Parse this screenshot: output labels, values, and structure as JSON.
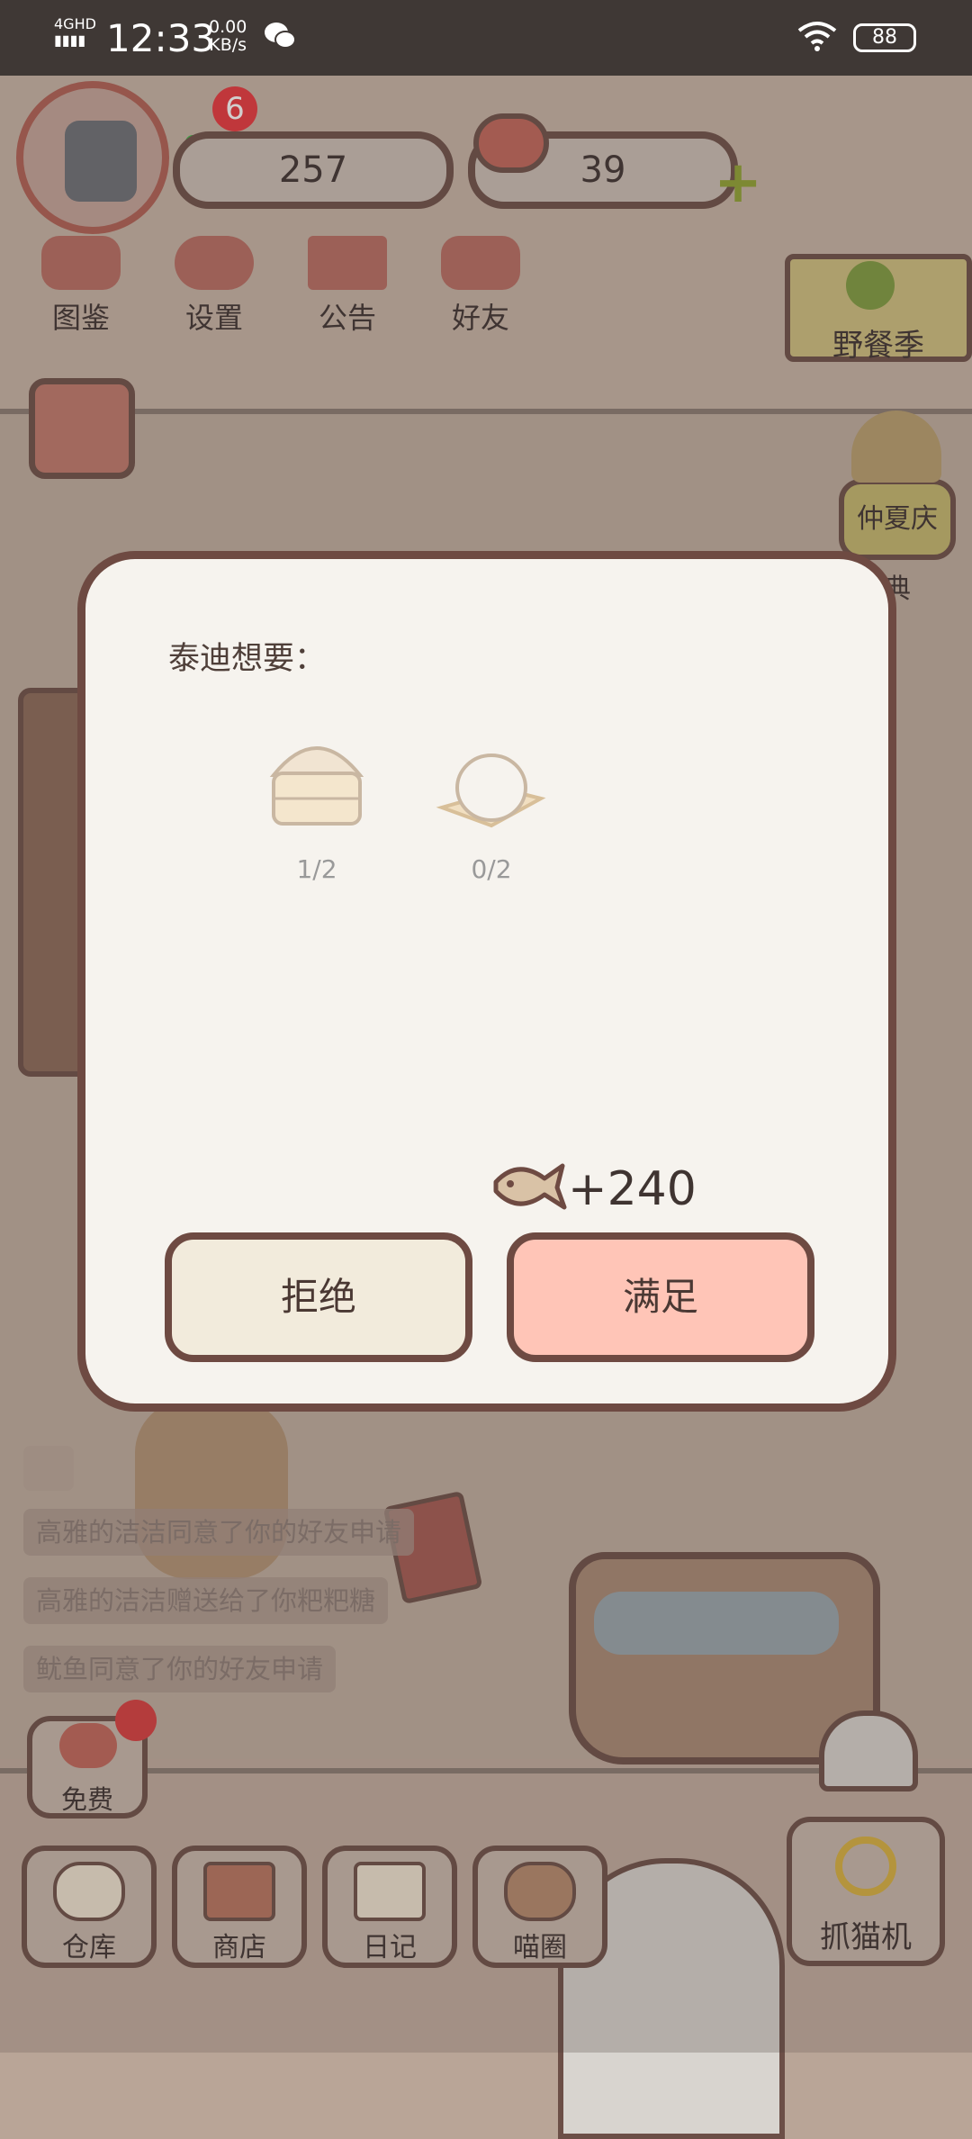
{
  "status_bar": {
    "network": "4GHD",
    "time": "12:33",
    "speed_value": "0.00",
    "speed_unit": "KB/s",
    "battery": "88"
  },
  "hud": {
    "notification_count": "6",
    "fish_currency": "257",
    "hearts": "39"
  },
  "top_menu": [
    {
      "label": "图鉴",
      "icon": "cat-face-icon"
    },
    {
      "label": "设置",
      "icon": "gear-icon"
    },
    {
      "label": "公告",
      "icon": "gift-icon"
    },
    {
      "label": "好友",
      "icon": "friends-icon"
    }
  ],
  "event_banner": "野餐季",
  "festival_button": "仲夏庆典",
  "dialog": {
    "title": "泰迪想要：",
    "items": [
      {
        "icon": "steamer-icon",
        "count": "1/2"
      },
      {
        "icon": "rice-ball-icon",
        "count": "0/2"
      }
    ],
    "reward": "+240",
    "reject_label": "拒绝",
    "accept_label": "满足"
  },
  "messages": [
    "高雅的洁洁同意了你的好友申请",
    "高雅的洁洁赠送给了你粑粑糖",
    "鱿鱼同意了你的好友申请"
  ],
  "free_button": "免费",
  "bottom_nav": [
    {
      "label": "仓库",
      "icon": "bowl-icon"
    },
    {
      "label": "商店",
      "icon": "shop-icon"
    },
    {
      "label": "日记",
      "icon": "diary-icon"
    },
    {
      "label": "喵圈",
      "icon": "cat-planet-icon"
    }
  ],
  "claw_machine": "抓猫机",
  "colors": {
    "accent_pink": "#ffc5b7",
    "cream": "#f2ebdc",
    "border_brown": "#6e4a42"
  }
}
